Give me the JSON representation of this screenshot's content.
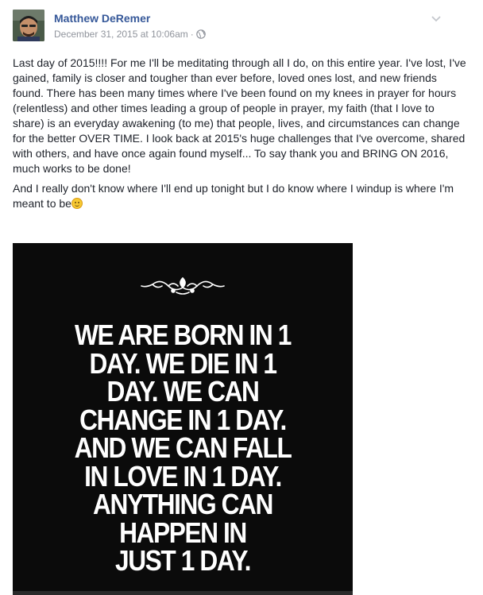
{
  "post": {
    "author": "Matthew DeRemer",
    "timestamp": "December 31, 2015 at 10:06am",
    "separator": "·",
    "audience_icon": "globe-icon",
    "options_icon": "chevron-down-icon",
    "paragraph_1": "Last day of 2015!!!! For me I'll be meditating through all I do, on this entire year. I've lost, I've gained, family is closer and tougher than ever before, loved ones lost, and new friends found. There has been many times where I've been found on my knees in prayer for hours (relentless) and other times leading a group of people in prayer, my faith (that I love to share) is an everyday awakening (to me) that people, lives, and circumstances can change for the better OVER TIME. I look back at 2015's huge challenges that I've overcome, shared with others, and have once again found myself... To say thank you and BRING ON 2016, much works to be done!",
    "paragraph_2": "And I really don't know where I'll end up tonight but I do know where I windup is where I'm meant to be",
    "emoji": "smiling-face-emoji"
  },
  "image": {
    "background": "#0b0b0b",
    "quote_lines": [
      "WE ARE BORN IN 1",
      "DAY. WE DIE IN 1",
      "DAY. WE CAN",
      "CHANGE IN 1 DAY.",
      "AND WE CAN FALL",
      "IN LOVE IN 1 DAY.",
      "ANYTHING CAN",
      "HAPPEN IN",
      "JUST 1 DAY."
    ]
  },
  "colors": {
    "link": "#365899",
    "meta": "#90949c",
    "text": "#1d2129"
  }
}
